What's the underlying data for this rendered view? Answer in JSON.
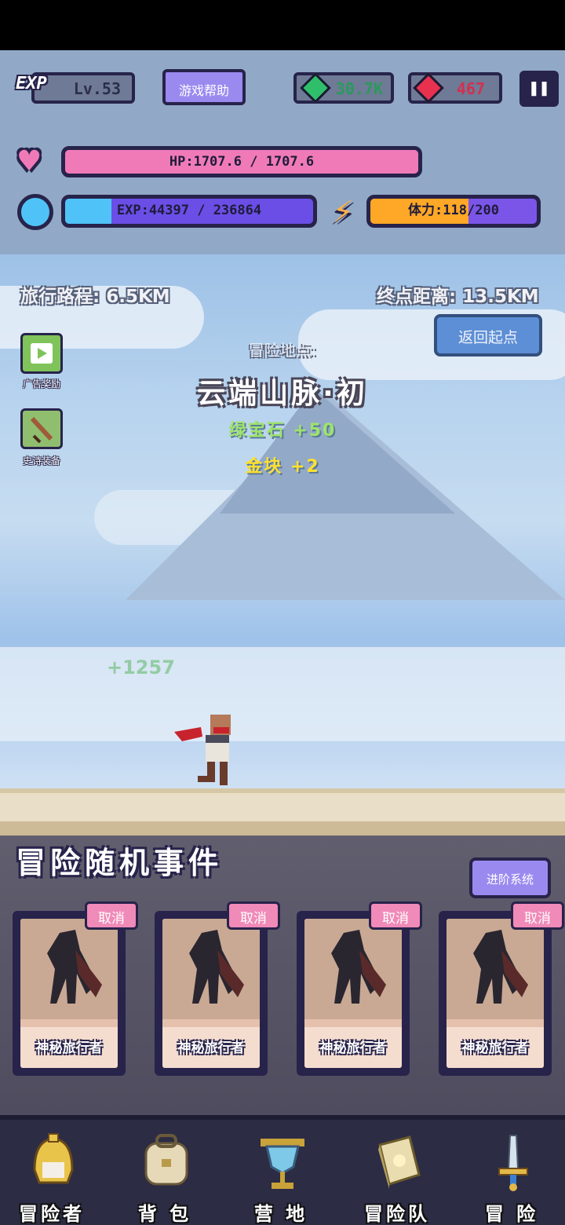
{
  "hud": {
    "exp_badge": "EXP",
    "level": "Lv.53",
    "help_button": "游戏帮助",
    "gems": "30.7K",
    "rubies": "467",
    "pause_icon": "pause-icon",
    "hp_text": "HP:1707.6 / 1707.6",
    "hp_fill": 1.0,
    "exp_text": "EXP:44397 / 236864",
    "exp_fill": 0.187,
    "stamina_text": "体力:118/200",
    "stamina_fill": 0.59,
    "colors": {
      "hp": "#f07ab8",
      "exp": "#4fc3f7",
      "stamina": "#ffa726",
      "panel": "#6f7a96",
      "outline": "#27234a"
    }
  },
  "journey": {
    "traveled": "旅行路程: 6.5KM",
    "remaining": "终点距离: 13.5KM",
    "return_button": "返回起点"
  },
  "side": {
    "ad_label": "广告奖励",
    "ad_icon": "play-icon",
    "epic_label": "史诗装备",
    "epic_icon": "sword-icon"
  },
  "location": {
    "label": "冒险地点:",
    "name": "云端山脉·初",
    "reward_1": "绿宝石 +50",
    "reward_2": "金块 +2",
    "floating_gain": "+1257"
  },
  "events": {
    "title": "冒险随机事件",
    "advance_button": "进阶系统",
    "cards": [
      {
        "name": "神秘旅行者",
        "cancel": "取消"
      },
      {
        "name": "神秘旅行者",
        "cancel": "取消"
      },
      {
        "name": "神秘旅行者",
        "cancel": "取消"
      },
      {
        "name": "神秘旅行者",
        "cancel": "取消"
      }
    ]
  },
  "nav": [
    {
      "label": "冒险者",
      "icon": "helmet-icon"
    },
    {
      "label": "背 包",
      "icon": "backpack-icon"
    },
    {
      "label": "营 地",
      "icon": "camp-banner-icon"
    },
    {
      "label": "冒险队",
      "icon": "book-icon"
    },
    {
      "label": "冒 险",
      "icon": "sword-icon"
    }
  ]
}
